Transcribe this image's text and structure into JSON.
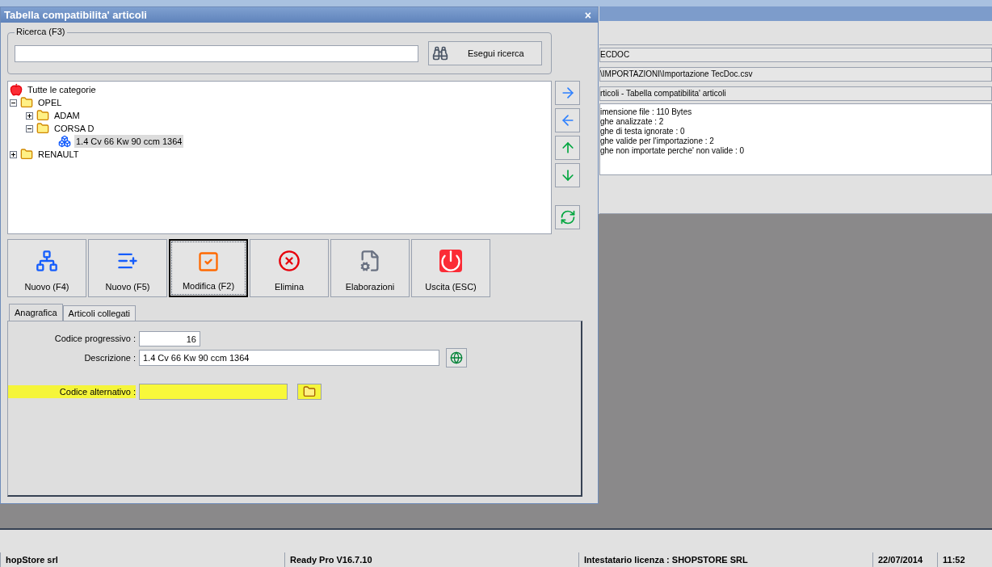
{
  "window": {
    "title": "Tabella compatibilita' articoli",
    "close": "×"
  },
  "search": {
    "group_label": "Ricerca (F3)",
    "button": "Esegui ricerca"
  },
  "tree": [
    {
      "label": "Tutte le categorie",
      "kind": "root",
      "selected": false,
      "children": [
        {
          "label": "OPEL",
          "kind": "folder",
          "selected": false,
          "expanded": true,
          "children": [
            {
              "label": "ADAM",
              "kind": "folder",
              "selected": false,
              "expanded": false
            },
            {
              "label": "CORSA D",
              "kind": "folder",
              "selected": false,
              "expanded": true,
              "children": [
                {
                  "label": "1.4 Cv 66 Kw 90 ccm 1364",
                  "kind": "item",
                  "selected": true
                }
              ]
            }
          ]
        },
        {
          "label": "RENAULT",
          "kind": "folder",
          "selected": false,
          "expanded": false
        }
      ]
    }
  ],
  "side_buttons": [
    {
      "kind": "right"
    },
    {
      "kind": "left"
    },
    {
      "kind": "up"
    },
    {
      "kind": "down"
    },
    {
      "kind": "refresh"
    }
  ],
  "toolbar": [
    {
      "label": "Nuovo (F4)",
      "kind": "new-branch",
      "focused": false
    },
    {
      "label": "Nuovo (F5)",
      "kind": "new-list",
      "focused": false
    },
    {
      "label": "Modifica (F2)",
      "kind": "edit",
      "focused": true
    },
    {
      "label": "Elimina",
      "kind": "delete",
      "focused": false
    },
    {
      "label": "Elaborazioni",
      "kind": "process",
      "focused": false
    },
    {
      "label": "Uscita (ESC)",
      "kind": "exit",
      "focused": false
    }
  ],
  "tabs": [
    {
      "label": "Anagrafica",
      "selected": true
    },
    {
      "label": "Articoli collegati",
      "selected": false
    }
  ],
  "form": [
    {
      "label": "Codice progressivo :",
      "value": "16",
      "kind": "number",
      "highlighted": false
    },
    {
      "label": "Descrizione :",
      "value": "1.4 Cv 66 Kw 90 ccm 1364",
      "kind": "globe",
      "highlighted": false
    },
    {
      "label": "Codice alternativo :",
      "kind": "folder",
      "highlighted": true
    }
  ],
  "background": {
    "fields": [
      "ECDOC",
      "\\IMPORTAZIONI\\Importazione TecDoc.csv",
      "rticoli - Tabella compatibilita' articoli"
    ],
    "log": [
      "imensione file : 110 Bytes",
      "ghe analizzate : 2",
      "ghe di testa ignorate : 0",
      "ghe valide per l'importazione : 2",
      "ghe non importate perche' non valide : 0"
    ]
  },
  "status_bar": [
    "hopStore srl",
    "Ready Pro V16.7.10",
    "Intestatario licenza : SHOPSTORE SRL",
    "22/07/2014",
    "11:52"
  ]
}
